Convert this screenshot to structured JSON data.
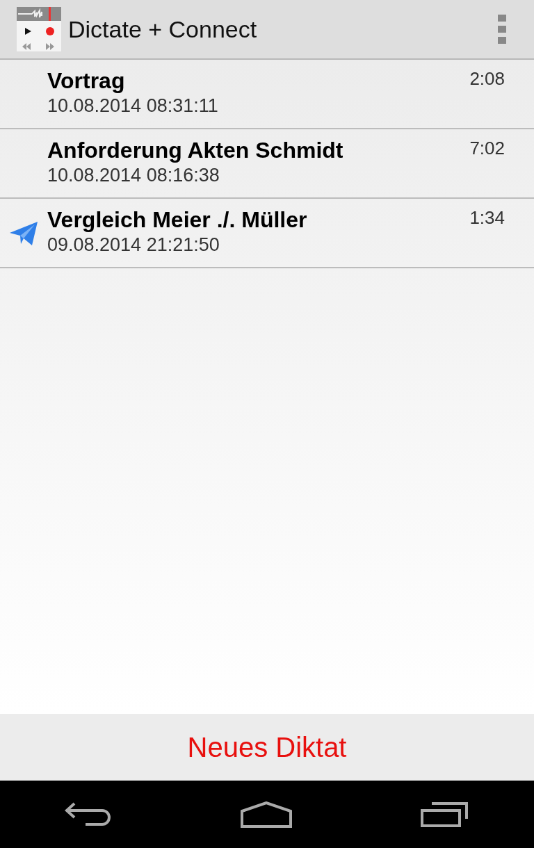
{
  "action_bar": {
    "title": "Dictate + Connect"
  },
  "dictations": [
    {
      "title": "Vortrag",
      "date": "10.08.2014 08:31:11",
      "duration": "2:08",
      "sent": false
    },
    {
      "title": "Anforderung Akten Schmidt",
      "date": "10.08.2014 08:16:38",
      "duration": "7:02",
      "sent": false
    },
    {
      "title": "Vergleich Meier ./. Müller",
      "date": "09.08.2014 21:21:50",
      "duration": "1:34",
      "sent": true
    }
  ],
  "bottom_button": {
    "label": "Neues Diktat"
  }
}
